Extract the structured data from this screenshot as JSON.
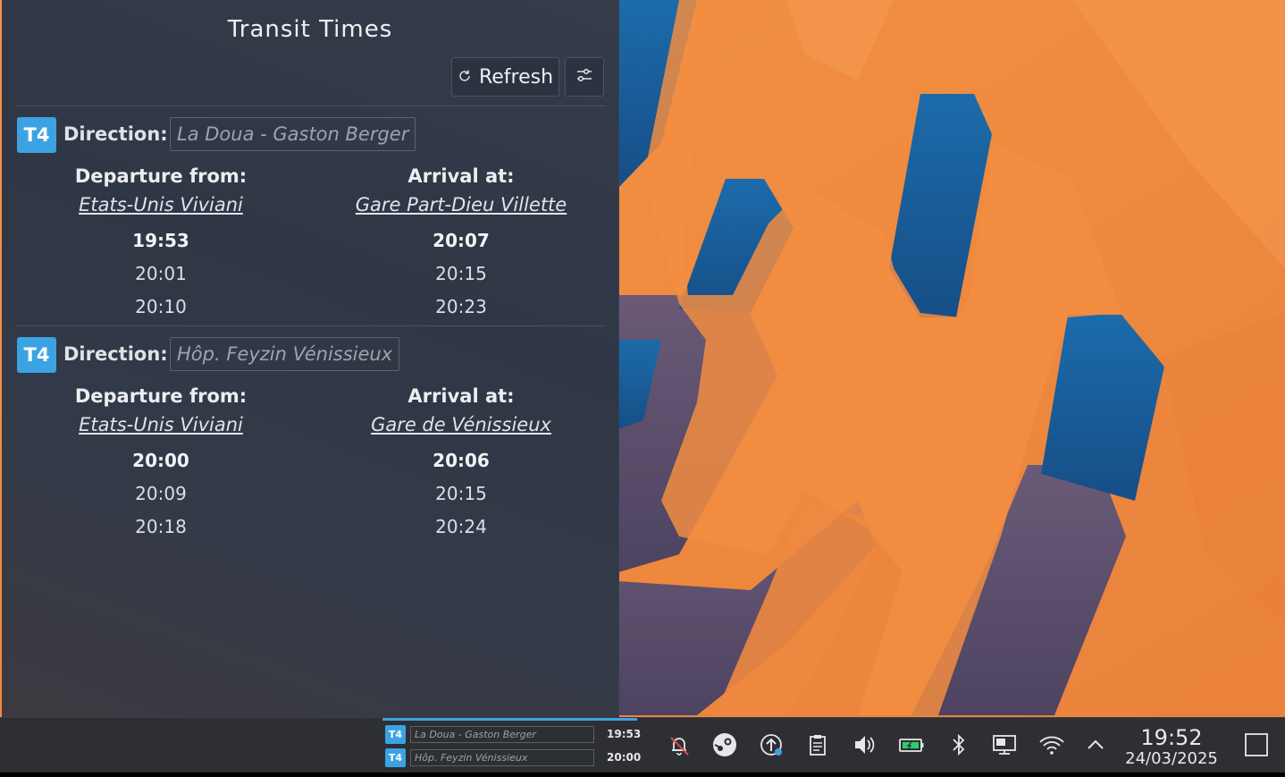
{
  "panel": {
    "title": "Transit Times",
    "refresh_label": "Refresh",
    "refresh_icon": "refresh-icon",
    "config_icon": "sliders-icon"
  },
  "routes": [
    {
      "line": "T4",
      "direction_label": "Direction:",
      "direction_value": "La Doua - Gaston Berger",
      "departure_label": "Departure from:",
      "departure_stop": "Etats-Unis Viviani",
      "arrival_label": "Arrival at:",
      "arrival_stop": "Gare Part-Dieu Villette",
      "departure_times": [
        "19:53",
        "20:01",
        "20:10"
      ],
      "arrival_times": [
        "20:07",
        "20:15",
        "20:23"
      ]
    },
    {
      "line": "T4",
      "direction_label": "Direction:",
      "direction_value": "Hôp. Feyzin Vénissieux",
      "departure_label": "Departure from:",
      "departure_stop": "Etats-Unis Viviani",
      "arrival_label": "Arrival at:",
      "arrival_stop": "Gare de Vénissieux",
      "departure_times": [
        "20:00",
        "20:09",
        "20:18"
      ],
      "arrival_times": [
        "20:06",
        "20:15",
        "20:24"
      ]
    }
  ],
  "taskbar": {
    "widget": [
      {
        "line": "T4",
        "direction": "La Doua - Gaston Berger",
        "time": "19:53"
      },
      {
        "line": "T4",
        "direction": "Hôp. Feyzin Vénissieux",
        "time": "20:00"
      }
    ],
    "tray_icons": [
      "notifications-disabled-icon",
      "steam-icon",
      "update-icon",
      "clipboard-icon",
      "volume-icon",
      "battery-icon",
      "bluetooth-icon",
      "display-icon",
      "wifi-icon",
      "chevron-up-icon"
    ],
    "clock_time": "19:52",
    "clock_date": "24/03/2025",
    "show_desktop_icon": "show-desktop-icon"
  },
  "colors": {
    "accent": "#3ba3e3",
    "wallpaper_orange": "#f08a3c",
    "wallpaper_blue": "#1a5f9a",
    "wallpaper_purple": "#5a4f6e"
  }
}
